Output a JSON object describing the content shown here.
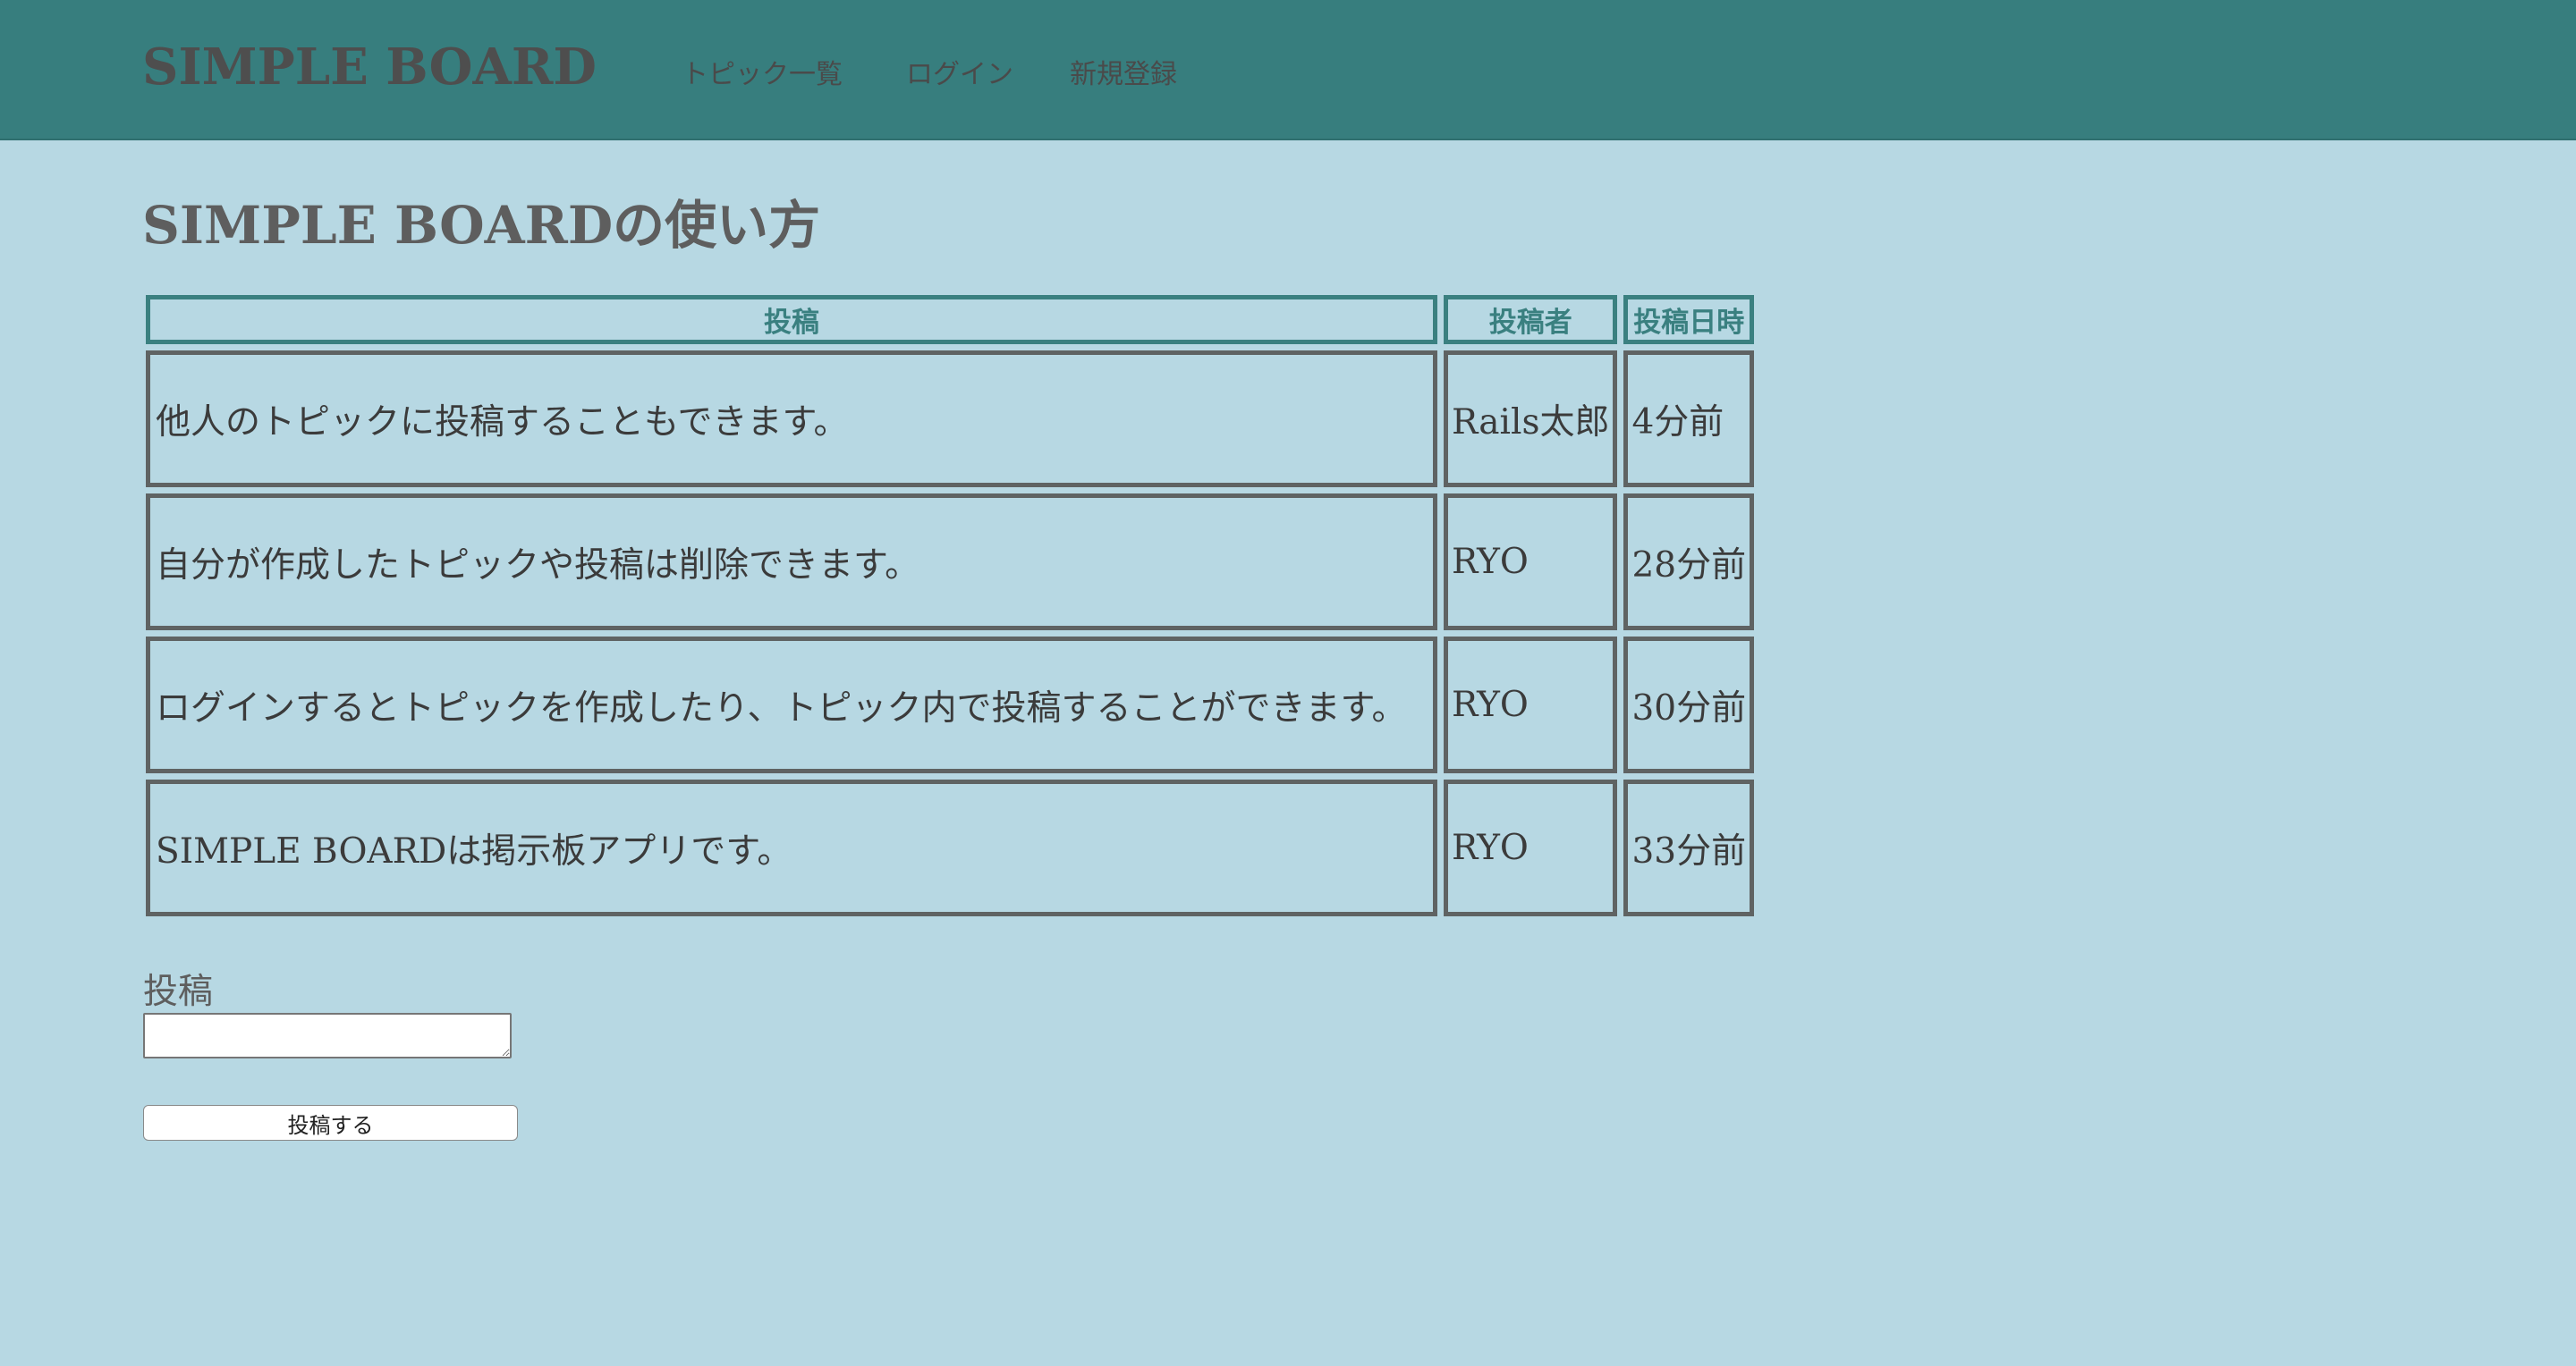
{
  "header": {
    "brand": "SIMPLE BOARD",
    "nav": [
      {
        "label": "トピック一覧"
      },
      {
        "label": "ログイン"
      },
      {
        "label": "新規登録"
      }
    ],
    "background_color": "#377e7e"
  },
  "page": {
    "title": "SIMPLE BOARDの使い方",
    "background_color": "#b7d8e3"
  },
  "table": {
    "columns": [
      "投稿",
      "投稿者",
      "投稿日時"
    ],
    "rows": [
      {
        "content": "他人のトピックに投稿することもできます。",
        "author": "Rails太郎",
        "date": "4分前"
      },
      {
        "content": "自分が作成したトピックや投稿は削除できます。",
        "author": "RYO",
        "date": "28分前"
      },
      {
        "content": "ログインするとトピックを作成したり、トピック内で投稿することができます。",
        "author": "RYO",
        "date": "30分前"
      },
      {
        "content": "SIMPLE BOARDは掲示板アプリです。",
        "author": "RYO",
        "date": "33分前"
      }
    ]
  },
  "form": {
    "label": "投稿",
    "textarea_value": "",
    "submit_label": "投稿する"
  }
}
